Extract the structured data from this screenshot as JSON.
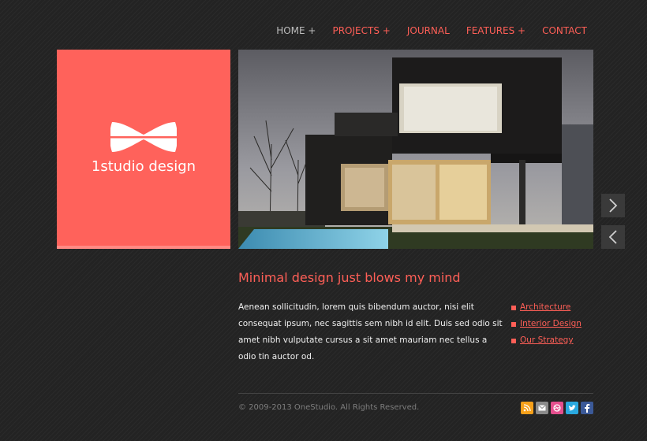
{
  "nav": {
    "items": [
      {
        "label": "HOME +",
        "state": "active"
      },
      {
        "label": "PROJECTS +",
        "state": "accent"
      },
      {
        "label": "JOURNAL",
        "state": "accent"
      },
      {
        "label": "FEATURES +",
        "state": "accent"
      },
      {
        "label": "CONTACT",
        "state": "accent"
      }
    ]
  },
  "brand": {
    "name": "1studio design",
    "color": "#ff625b",
    "logo_icon": "bowtie-icon"
  },
  "hero": {
    "image_subject": "house-photo"
  },
  "slider": {
    "next_icon": "chevron-right-icon",
    "prev_icon": "chevron-left-icon"
  },
  "content": {
    "headline": "Minimal design just blows my mind",
    "body": "Aenean sollicitudin, lorem quis bibendum auctor, nisi elit consequat ipsum, nec sagittis sem nibh id elit. Duis sed odio sit amet nibh vulputate cursus a sit amet mauriam nec tellus a odio tin auctor od.",
    "links": [
      "Architecture",
      "Interior Design",
      "Our Strategy"
    ]
  },
  "footer": {
    "copyright": "© 2009-2013 OneStudio. All Rights Reserved.",
    "social": [
      {
        "icon": "rss-icon",
        "color": "#f6a01a"
      },
      {
        "icon": "email-icon",
        "color": "#8a8a8a"
      },
      {
        "icon": "dribbble-icon",
        "color": "#e54f8e"
      },
      {
        "icon": "twitter-icon",
        "color": "#2aa9e0"
      },
      {
        "icon": "facebook-icon",
        "color": "#3b5998"
      }
    ]
  },
  "colors": {
    "accent": "#ff5f57",
    "background": "#252525"
  }
}
